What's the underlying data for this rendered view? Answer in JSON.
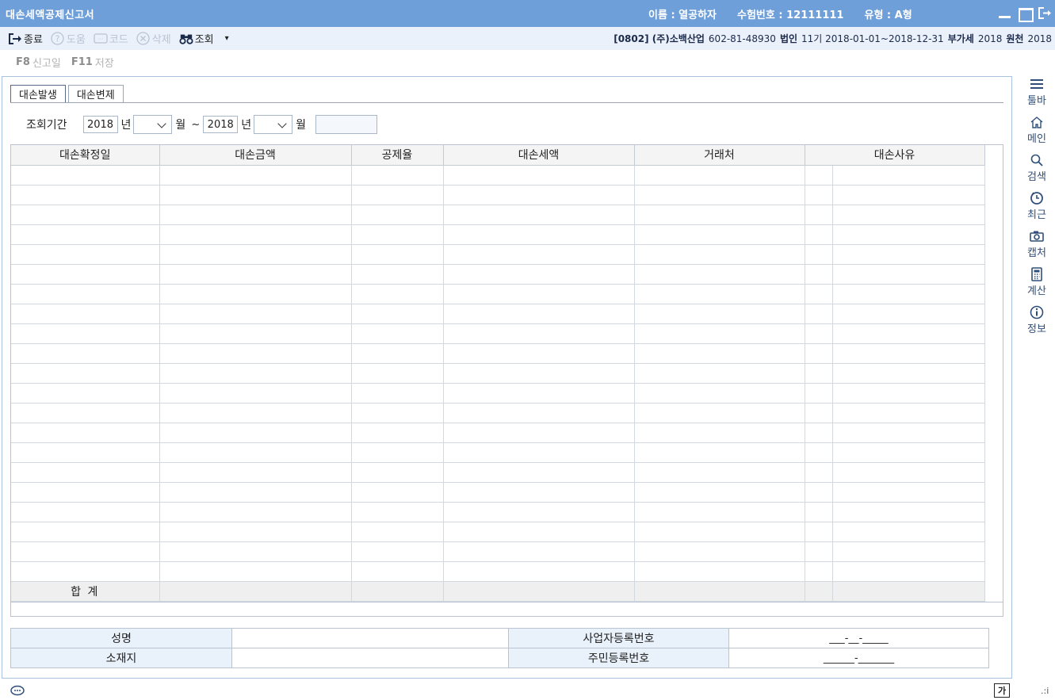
{
  "window": {
    "title": "대손세액공제신고서",
    "user_name": "이름 : 열공하자",
    "exam_no": "수험번호 : 12111111",
    "type": "유형 : A형"
  },
  "toolbar": {
    "close": "종료",
    "help": "도움",
    "code": "코드",
    "delete": "삭제",
    "search": "조회",
    "dropdown": "▾"
  },
  "company": {
    "code_name": "[0802] (주)소백산업",
    "biz_no": "602-81-48930",
    "corp_label": "법인",
    "period": "11기 2018-01-01~2018-12-31",
    "vat_label": "부가세",
    "vat_year": "2018",
    "source_label": "원천",
    "source_year": "2018"
  },
  "subtoolbar": {
    "f8_key": "F8",
    "f8_label": "신고일",
    "f11_key": "F11",
    "f11_label": "저장"
  },
  "tabs": {
    "occur": "대손발생",
    "repay": "대손변제"
  },
  "period": {
    "label": "조회기간",
    "from_year": "2018",
    "year_unit": "년",
    "month_unit": "월",
    "tilde": "~",
    "to_year": "2018"
  },
  "grid": {
    "headers": [
      "대손확정일",
      "대손금액",
      "공제율",
      "대손세액",
      "거래처",
      "대손사유"
    ],
    "total_label": "합    계"
  },
  "info": {
    "name_label": "성명",
    "address_label": "소재지",
    "bizreg_label": "사업자등록번호",
    "bizreg_value": "___-__-_____",
    "resident_label": "주민등록번호",
    "resident_value": "______-_______"
  },
  "sidebar": {
    "toolbar": "툴바",
    "main": "메인",
    "search": "검색",
    "recent": "최근",
    "capture": "캡처",
    "calc": "계산",
    "info": "정보"
  },
  "statusbar": {
    "ime": "가",
    "grip": ".:i"
  }
}
